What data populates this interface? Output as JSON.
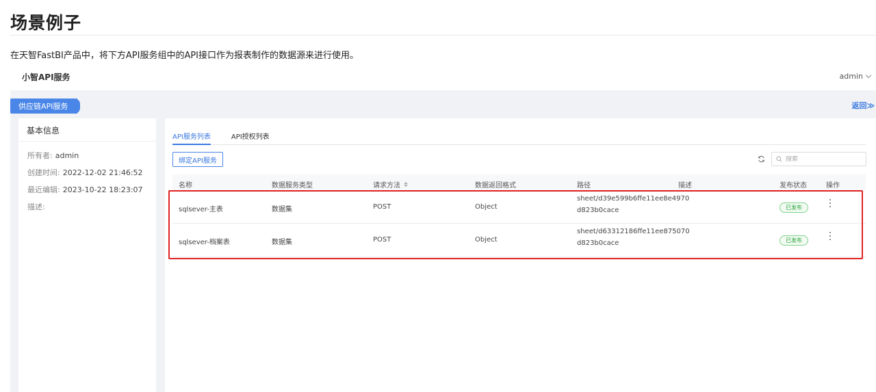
{
  "doc": {
    "title": "场景例子",
    "intro": "在天智FastBI产品中，将下方API服务组中的API接口作为报表制作的数据源来进行使用。"
  },
  "header": {
    "brand": "小智API服务",
    "user": "admin"
  },
  "group": {
    "label": "供应链API服务",
    "back_label": "返回≫"
  },
  "info": {
    "title": "基本信息",
    "owner_label": "所有者:",
    "owner": "admin",
    "created_label": "创建时间:",
    "created": "2022-12-02 21:46:52",
    "edited_label": "最近编辑:",
    "edited": "2023-10-22 18:23:07",
    "desc_label": "描述:"
  },
  "tabs": [
    {
      "label": "API服务列表",
      "active": true
    },
    {
      "label": "API授权列表",
      "active": false
    }
  ],
  "toolbar": {
    "bind_label": "绑定API服务",
    "search_placeholder": "搜索"
  },
  "table": {
    "columns": [
      "名称",
      "数据服务类型",
      "请求方法",
      "数据返回格式",
      "路径",
      "描述",
      "发布状态",
      "操作"
    ],
    "rows": [
      {
        "name": "sqlsever-主表",
        "type": "数据集",
        "method": "POST",
        "format": "Object",
        "path_line1": "sheet/d39e599b6ffe11ee8e4970",
        "path_line2": "d823b0cace",
        "desc": "",
        "status": "已发布"
      },
      {
        "name": "sqlsever-档案表",
        "type": "数据集",
        "method": "POST",
        "format": "Object",
        "path_line1": "sheet/d63312186ffe11ee875070",
        "path_line2": "d823b0cace",
        "desc": "",
        "status": "已发布"
      }
    ]
  },
  "colors": {
    "accent": "#3a78e0",
    "highlight": "#e02020",
    "status_green": "#2fa33f"
  }
}
